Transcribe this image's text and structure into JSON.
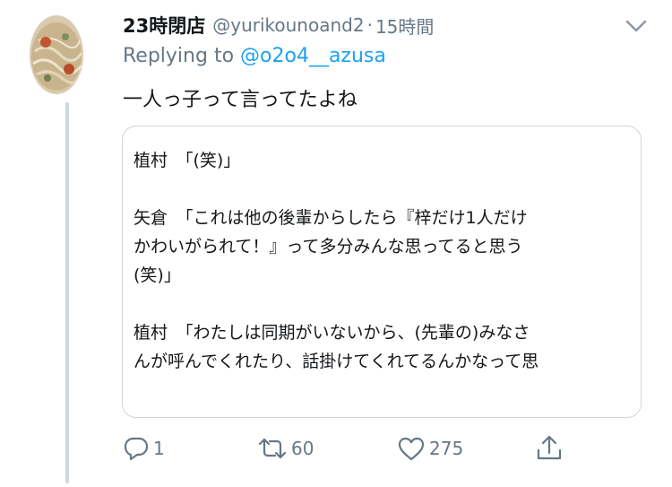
{
  "tweet": {
    "display_name": "23時閉店",
    "handle": "@yurikounoand2",
    "separator": "·",
    "time": "15時間",
    "replying_prefix": "Replying to",
    "replying_to": "@o2o4__azusa",
    "text": "一人っ子って言ってたよね"
  },
  "quote_card": {
    "lines": [
      "植村　「(笑)」",
      "",
      "矢倉　「これは他の後輩からしたら『梓だけ1人だけ",
      "かわいがられて！』って多分みんな思ってると思う",
      "(笑)」",
      "",
      "植村　「わたしは同期がいないから、(先輩の)みなさ",
      "んが呼んでくれたり、話掛けてくれてるんかなって思"
    ]
  },
  "actions": {
    "reply_count": "1",
    "retweet_count": "60",
    "like_count": "275"
  },
  "icons": [
    "avatar-image",
    "chevron-down-icon",
    "reply-icon",
    "retweet-icon",
    "like-icon",
    "share-icon"
  ],
  "colors": {
    "text": "#14171a",
    "secondary": "#657786",
    "link": "#1da1f2",
    "border": "#ccd6dd",
    "thread_line": "#cfd6dc"
  }
}
